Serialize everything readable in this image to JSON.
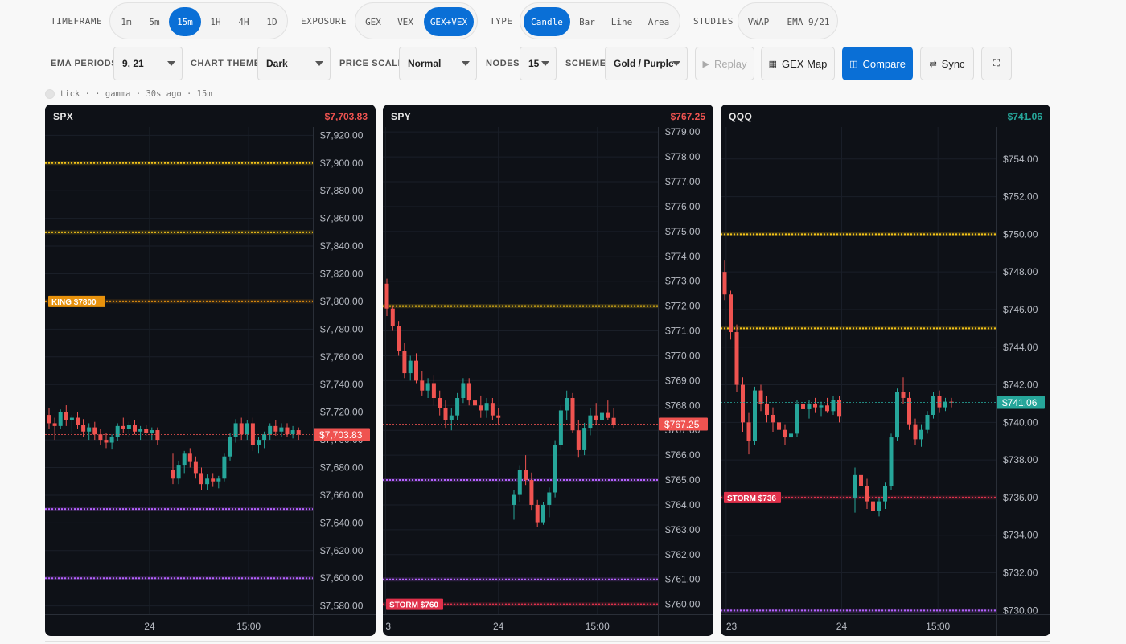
{
  "toolbar": {
    "timeframe": {
      "label": "TIMEFRAME",
      "options": [
        "1m",
        "5m",
        "15m",
        "1H",
        "4H",
        "1D"
      ],
      "selected": "15m"
    },
    "exposure": {
      "label": "EXPOSURE",
      "options": [
        "GEX",
        "VEX",
        "GEX+VEX"
      ],
      "selected": "GEX+VEX"
    },
    "type": {
      "label": "TYPE",
      "options": [
        "Candle",
        "Bar",
        "Line",
        "Area"
      ],
      "selected": "Candle"
    },
    "studies": {
      "label": "STUDIES",
      "options": [
        "VWAP",
        "EMA 9/21"
      ]
    },
    "ema_periods": {
      "label": "EMA PERIODS",
      "value": "9, 21"
    },
    "chart_theme": {
      "label": "CHART THEME",
      "value": "Dark"
    },
    "price_scale": {
      "label": "PRICE SCALE",
      "value": "Normal"
    },
    "nodes": {
      "label": "NODES",
      "value": "15"
    },
    "scheme": {
      "label": "SCHEME",
      "value": "Gold / Purple"
    },
    "buttons": {
      "replay": "Replay",
      "gex_map": "GEX Map",
      "compare": "Compare",
      "sync": "Sync"
    }
  },
  "status": {
    "text": "tick · · gamma · 30s ago · 15m"
  },
  "colors": {
    "up": "#26a69a",
    "down": "#ef5350",
    "accent": "#0a6fd6",
    "gold": "#f5c518",
    "purple": "#b561ff",
    "king": "#e8920c",
    "storm": "#e0314b"
  },
  "panels": [
    {
      "symbol": "SPX",
      "price_label": "$7,703.83",
      "price_color": "#ef5350",
      "x_labels": [
        "24",
        "15:00"
      ],
      "level_labels": [
        {
          "text": "KING $7800",
          "kind": "king"
        }
      ]
    },
    {
      "symbol": "SPY",
      "price_label": "$767.25",
      "price_color": "#ef5350",
      "x_labels": [
        "3",
        "24",
        "15:00"
      ],
      "level_labels": [
        {
          "text": "STORM $760",
          "kind": "storm"
        }
      ]
    },
    {
      "symbol": "QQQ",
      "price_label": "$741.06",
      "price_color": "#26a69a",
      "x_labels": [
        "23",
        "24",
        "15:00"
      ],
      "level_labels": [
        {
          "text": "STORM $736",
          "kind": "storm"
        }
      ]
    }
  ],
  "chart_data": [
    {
      "type": "candlestick",
      "title": "SPX",
      "y_ticks": [
        "$7,920.00",
        "$7,900.00",
        "$7,880.00",
        "$7,860.00",
        "$7,840.00",
        "$7,820.00",
        "$7,800.00",
        "$7,780.00",
        "$7,760.00",
        "$7,740.00",
        "$7,720.00",
        "$7,700.00",
        "$7,680.00",
        "$7,660.00",
        "$7,640.00",
        "$7,620.00",
        "$7,600.00",
        "$7,580.00"
      ],
      "ylim": [
        7574,
        7926
      ],
      "last_price": 7703.83,
      "levels": [
        {
          "price": 7900,
          "color": "gold"
        },
        {
          "price": 7850,
          "color": "gold"
        },
        {
          "price": 7800,
          "color": "king"
        },
        {
          "price": 7650,
          "color": "purple"
        },
        {
          "price": 7600,
          "color": "purple"
        }
      ],
      "candles": [
        [
          7718,
          7723,
          7708,
          7712
        ],
        [
          7712,
          7716,
          7700,
          7710
        ],
        [
          7710,
          7722,
          7708,
          7720
        ],
        [
          7720,
          7725,
          7710,
          7714
        ],
        [
          7714,
          7718,
          7705,
          7716
        ],
        [
          7716,
          7720,
          7708,
          7711
        ],
        [
          7711,
          7715,
          7702,
          7706
        ],
        [
          7706,
          7712,
          7700,
          7709
        ],
        [
          7709,
          7713,
          7700,
          7704
        ],
        [
          7704,
          7708,
          7696,
          7700
        ],
        [
          7700,
          7705,
          7694,
          7698
        ],
        [
          7698,
          7704,
          7693,
          7702
        ],
        [
          7702,
          7712,
          7699,
          7710
        ],
        [
          7710,
          7716,
          7705,
          7708
        ],
        [
          7708,
          7713,
          7702,
          7711
        ],
        [
          7711,
          7714,
          7704,
          7706
        ],
        [
          7706,
          7710,
          7700,
          7708
        ],
        [
          7708,
          7711,
          7703,
          7705
        ],
        [
          7705,
          7709,
          7700,
          7707
        ],
        [
          7707,
          7709,
          7696,
          7700
        ],
        [
          7678,
          7690,
          7668,
          7672
        ],
        [
          7672,
          7685,
          7668,
          7682
        ],
        [
          7682,
          7692,
          7676,
          7690
        ],
        [
          7690,
          7694,
          7680,
          7684
        ],
        [
          7684,
          7688,
          7672,
          7676
        ],
        [
          7676,
          7680,
          7664,
          7668
        ],
        [
          7668,
          7675,
          7664,
          7672
        ],
        [
          7672,
          7676,
          7666,
          7670
        ],
        [
          7670,
          7674,
          7665,
          7672
        ],
        [
          7672,
          7690,
          7670,
          7688
        ],
        [
          7688,
          7705,
          7685,
          7702
        ],
        [
          7702,
          7715,
          7698,
          7712
        ],
        [
          7712,
          7716,
          7700,
          7704
        ],
        [
          7704,
          7714,
          7700,
          7712
        ],
        [
          7712,
          7716,
          7692,
          7696
        ],
        [
          7696,
          7702,
          7690,
          7700
        ],
        [
          7700,
          7706,
          7694,
          7704
        ],
        [
          7704,
          7712,
          7700,
          7710
        ],
        [
          7710,
          7714,
          7703,
          7706
        ],
        [
          7706,
          7712,
          7702,
          7709
        ],
        [
          7709,
          7712,
          7702,
          7704
        ],
        [
          7704,
          7710,
          7701,
          7707
        ],
        [
          7707,
          7709,
          7700,
          7704
        ]
      ]
    },
    {
      "type": "candlestick",
      "title": "SPY",
      "y_ticks": [
        "$779.00",
        "$778.00",
        "$777.00",
        "$776.00",
        "$775.00",
        "$774.00",
        "$773.00",
        "$772.00",
        "$771.00",
        "$770.00",
        "$769.00",
        "$768.00",
        "$767.00",
        "$766.00",
        "$765.00",
        "$764.00",
        "$763.00",
        "$762.00",
        "$761.00",
        "$760.00"
      ],
      "ylim": [
        759.6,
        779.2
      ],
      "last_price": 767.25,
      "levels": [
        {
          "price": 772,
          "color": "gold"
        },
        {
          "price": 765,
          "color": "purple"
        },
        {
          "price": 761,
          "color": "purple"
        },
        {
          "price": 760,
          "color": "storm"
        }
      ],
      "candles": [
        [
          772.9,
          773.1,
          771.6,
          771.9
        ],
        [
          771.9,
          772.0,
          771.0,
          771.2
        ],
        [
          771.2,
          771.4,
          770.0,
          770.2
        ],
        [
          770.2,
          770.5,
          769.1,
          769.3
        ],
        [
          769.3,
          770.0,
          769.0,
          769.8
        ],
        [
          769.8,
          770.1,
          768.9,
          769.0
        ],
        [
          769.0,
          769.4,
          768.4,
          768.6
        ],
        [
          768.6,
          769.1,
          768.3,
          768.9
        ],
        [
          768.9,
          769.2,
          768.0,
          768.3
        ],
        [
          768.3,
          768.6,
          767.6,
          767.9
        ],
        [
          767.9,
          768.2,
          767.1,
          767.4
        ],
        [
          767.4,
          767.9,
          767.0,
          767.6
        ],
        [
          767.6,
          768.5,
          767.4,
          768.3
        ],
        [
          768.3,
          769.1,
          768.1,
          768.9
        ],
        [
          768.9,
          769.1,
          768.0,
          768.2
        ],
        [
          768.2,
          768.6,
          767.6,
          768.0
        ],
        [
          768.0,
          768.4,
          767.5,
          767.8
        ],
        [
          767.8,
          768.3,
          767.5,
          768.1
        ],
        [
          768.1,
          768.3,
          767.4,
          767.6
        ],
        [
          767.6,
          767.9,
          767.2,
          767.5
        ],
        [
          764.0,
          764.6,
          763.4,
          764.4
        ],
        [
          764.4,
          765.6,
          764.1,
          765.4
        ],
        [
          765.4,
          766.0,
          764.8,
          765.0
        ],
        [
          765.0,
          765.3,
          763.8,
          764.0
        ],
        [
          764.0,
          764.2,
          763.1,
          763.3
        ],
        [
          763.3,
          764.1,
          763.2,
          764.0
        ],
        [
          764.0,
          764.7,
          763.5,
          764.5
        ],
        [
          764.5,
          766.6,
          764.3,
          766.4
        ],
        [
          766.4,
          768.0,
          766.2,
          767.8
        ],
        [
          767.8,
          768.6,
          767.4,
          768.3
        ],
        [
          768.3,
          768.5,
          766.9,
          767.0
        ],
        [
          767.0,
          767.4,
          765.9,
          766.2
        ],
        [
          766.2,
          767.3,
          766.0,
          767.1
        ],
        [
          767.1,
          767.9,
          766.8,
          767.6
        ],
        [
          767.6,
          768.1,
          767.2,
          767.4
        ],
        [
          767.4,
          767.9,
          767.1,
          767.7
        ],
        [
          767.7,
          768.2,
          767.4,
          767.5
        ],
        [
          767.5,
          767.9,
          767.1,
          767.2
        ]
      ]
    },
    {
      "type": "candlestick",
      "title": "QQQ",
      "y_ticks": [
        "$754.00",
        "$752.00",
        "$750.00",
        "$748.00",
        "$746.00",
        "$744.00",
        "$742.00",
        "$740.00",
        "$738.00",
        "$736.00",
        "$734.00",
        "$732.00",
        "$730.00"
      ],
      "ylim": [
        729.8,
        755.7
      ],
      "last_price": 741.06,
      "levels": [
        {
          "price": 750,
          "color": "gold"
        },
        {
          "price": 745,
          "color": "gold"
        },
        {
          "price": 736,
          "color": "storm"
        },
        {
          "price": 730,
          "color": "purple"
        }
      ],
      "candles": [
        [
          748.0,
          748.6,
          746.5,
          746.8
        ],
        [
          746.8,
          747.0,
          744.4,
          744.8
        ],
        [
          744.8,
          745.2,
          741.6,
          742.0
        ],
        [
          742.0,
          742.4,
          739.5,
          740.0
        ],
        [
          740.0,
          740.5,
          738.3,
          739.0
        ],
        [
          739.0,
          741.9,
          738.8,
          741.7
        ],
        [
          741.7,
          742.0,
          740.6,
          741.0
        ],
        [
          741.0,
          741.4,
          740.0,
          740.4
        ],
        [
          740.4,
          740.8,
          739.5,
          740.0
        ],
        [
          740.0,
          740.5,
          739.2,
          739.6
        ],
        [
          739.6,
          739.9,
          738.8,
          739.2
        ],
        [
          739.2,
          739.8,
          738.6,
          739.4
        ],
        [
          739.4,
          741.2,
          739.2,
          741.0
        ],
        [
          741.0,
          741.4,
          740.3,
          740.7
        ],
        [
          740.7,
          741.2,
          740.2,
          741.0
        ],
        [
          741.0,
          741.3,
          740.5,
          740.8
        ],
        [
          740.8,
          741.1,
          740.3,
          740.9
        ],
        [
          740.9,
          741.3,
          740.5,
          740.6
        ],
        [
          740.6,
          741.4,
          740.4,
          741.2
        ],
        [
          741.2,
          741.4,
          740.0,
          740.3
        ],
        [
          736.0,
          737.6,
          735.2,
          737.2
        ],
        [
          737.2,
          737.8,
          736.4,
          736.6
        ],
        [
          736.6,
          737.0,
          735.4,
          735.8
        ],
        [
          735.8,
          736.4,
          735.0,
          735.3
        ],
        [
          735.3,
          736.0,
          735.0,
          735.8
        ],
        [
          735.8,
          736.8,
          735.4,
          736.6
        ],
        [
          736.6,
          739.4,
          736.4,
          739.2
        ],
        [
          739.2,
          741.8,
          739.0,
          741.6
        ],
        [
          741.6,
          742.4,
          741.0,
          741.3
        ],
        [
          741.3,
          741.6,
          739.6,
          739.9
        ],
        [
          739.9,
          740.2,
          738.8,
          739.1
        ],
        [
          739.1,
          739.9,
          738.7,
          739.6
        ],
        [
          739.6,
          740.6,
          739.4,
          740.4
        ],
        [
          740.4,
          741.6,
          740.2,
          741.4
        ],
        [
          741.4,
          741.7,
          740.5,
          740.8
        ],
        [
          740.8,
          741.3,
          740.6,
          741.1
        ],
        [
          741.1,
          741.3,
          740.8,
          741.06
        ]
      ]
    }
  ]
}
